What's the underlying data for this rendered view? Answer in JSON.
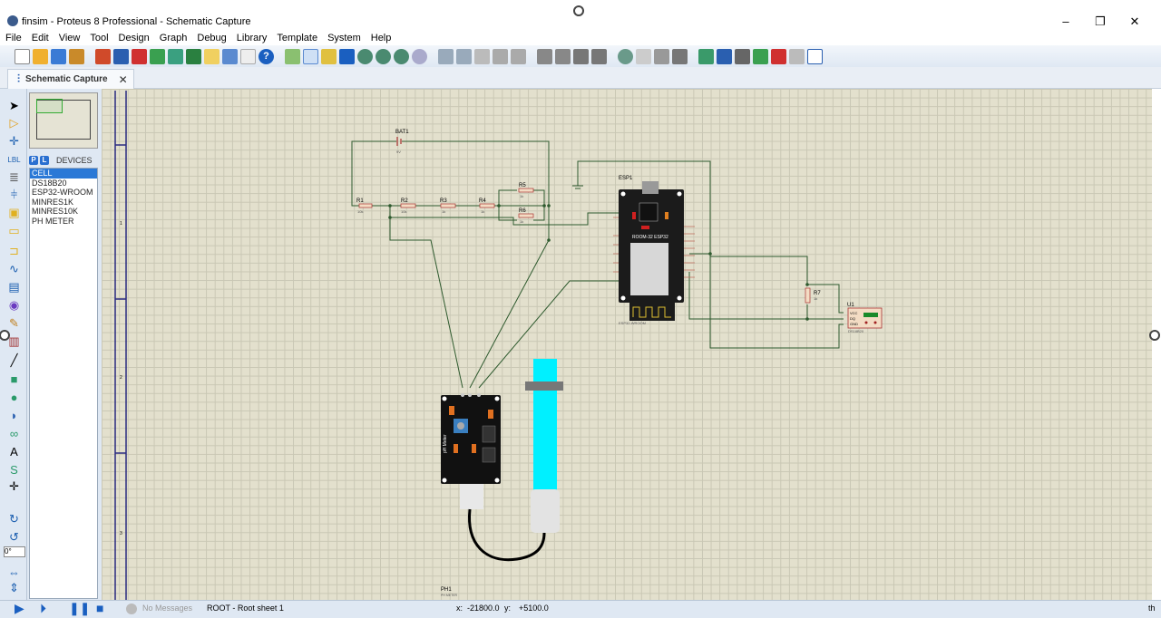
{
  "window": {
    "title": "finsim - Proteus 8 Professional - Schematic Capture",
    "minimize": "–",
    "restore": "❐",
    "close": "✕"
  },
  "menu": [
    "File",
    "Edit",
    "View",
    "Tool",
    "Design",
    "Graph",
    "Debug",
    "Library",
    "Template",
    "System",
    "Help"
  ],
  "tab": {
    "label": "Schematic Capture",
    "close": "✕"
  },
  "devices": {
    "header": "DEVICES",
    "p": "P",
    "l": "L",
    "items": [
      "CELL",
      "DS18B20",
      "ESP32-WROOM",
      "MINRES1K",
      "MINRES10K",
      "PH METER"
    ],
    "selected": "CELL"
  },
  "rotation_value": "0°",
  "schematic": {
    "bat": {
      "ref": "BAT1",
      "value": "9V"
    },
    "resistors": [
      {
        "ref": "R1",
        "value": "10k"
      },
      {
        "ref": "R2",
        "value": "10k"
      },
      {
        "ref": "R3",
        "value": "1k"
      },
      {
        "ref": "R4",
        "value": "1k"
      },
      {
        "ref": "R5",
        "value": "1k"
      },
      {
        "ref": "R6",
        "value": "1k"
      },
      {
        "ref": "R7",
        "value": "1k"
      }
    ],
    "esp": {
      "ref": "ESP1",
      "part": "ESP32-WROOM",
      "board_text": "ROOM-32 ESP32"
    },
    "u1": {
      "ref": "U1",
      "part": "DS18B20",
      "pins": [
        "VCC",
        "DQ",
        "GND"
      ]
    },
    "ph": {
      "ref": "PH1",
      "part": "PH METER",
      "board_text": "pH Meter"
    },
    "margin_marks": [
      "1",
      "2",
      "3"
    ]
  },
  "status": {
    "messages": "No Messages",
    "sheet": "ROOT - Root sheet 1",
    "x_label": "x:",
    "x": "-21800.0",
    "y_label": "y:",
    "y": "+5100.0",
    "right": "th"
  }
}
